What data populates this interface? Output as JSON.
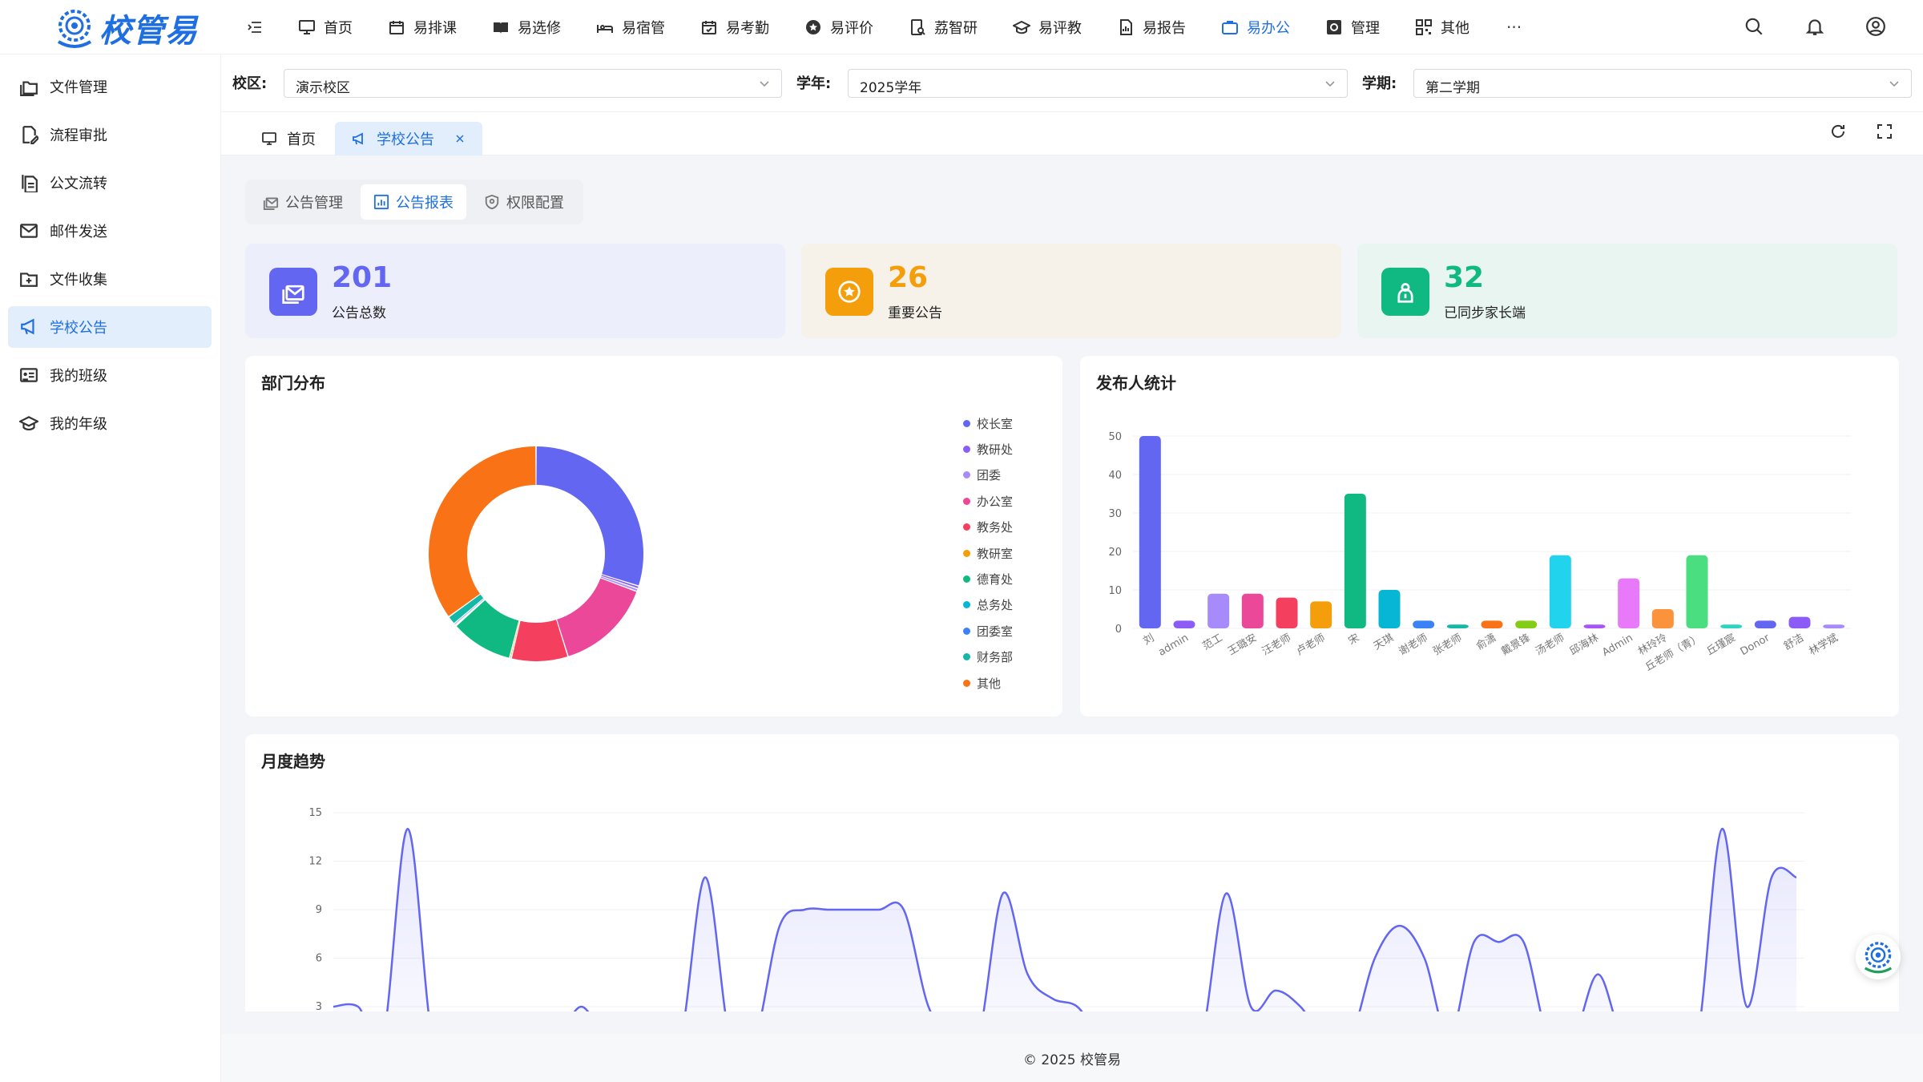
{
  "app": {
    "logo_text": "校管易"
  },
  "nav": [
    {
      "label": "首页",
      "icon": "monitor-icon"
    },
    {
      "label": "易排课",
      "icon": "calendar-icon"
    },
    {
      "label": "易选修",
      "icon": "book-icon"
    },
    {
      "label": "易宿管",
      "icon": "bed-icon"
    },
    {
      "label": "易考勤",
      "icon": "calendar-check-icon"
    },
    {
      "label": "易评价",
      "icon": "star-badge-icon"
    },
    {
      "label": "荔智研",
      "icon": "research-icon"
    },
    {
      "label": "易评教",
      "icon": "graduation-cap-icon"
    },
    {
      "label": "易报告",
      "icon": "report-icon"
    },
    {
      "label": "易办公",
      "icon": "briefcase-icon",
      "active": true
    },
    {
      "label": "管理",
      "icon": "settings-box-icon"
    },
    {
      "label": "其他",
      "icon": "grid-icon"
    }
  ],
  "nav_more": "···",
  "sidebar": [
    {
      "label": "文件管理",
      "icon": "folders-icon"
    },
    {
      "label": "流程审批",
      "icon": "doc-edit-icon"
    },
    {
      "label": "公文流转",
      "icon": "documents-icon"
    },
    {
      "label": "邮件发送",
      "icon": "mail-icon"
    },
    {
      "label": "文件收集",
      "icon": "folder-add-icon"
    },
    {
      "label": "学校公告",
      "icon": "megaphone-icon",
      "active": true
    },
    {
      "label": "我的班级",
      "icon": "class-board-icon"
    },
    {
      "label": "我的年级",
      "icon": "graduation-cap-icon"
    }
  ],
  "filters": {
    "campus_label": "校区:",
    "campus_value": "演示校区",
    "year_label": "学年:",
    "year_value": "2025学年",
    "term_label": "学期:",
    "term_value": "第二学期"
  },
  "page_tabs": [
    {
      "label": "首页",
      "icon": "monitor-icon"
    },
    {
      "label": "学校公告",
      "icon": "megaphone-icon",
      "active": true,
      "closable": true
    }
  ],
  "segments": [
    {
      "label": "公告管理",
      "icon": "mail-stack-icon"
    },
    {
      "label": "公告报表",
      "icon": "chart-icon",
      "active": true
    },
    {
      "label": "权限配置",
      "icon": "shield-icon"
    }
  ],
  "stats": [
    {
      "value": "201",
      "label": "公告总数",
      "color": "#6366f1",
      "bg": "#eceefb",
      "icon": "mail-stack-icon"
    },
    {
      "value": "26",
      "label": "重要公告",
      "color": "#f59e0b",
      "bg": "#f6f1e9",
      "icon": "star-circle-icon"
    },
    {
      "value": "32",
      "label": "已同步家长端",
      "color": "#10b981",
      "bg": "#e8f5f0",
      "icon": "parent-icon"
    }
  ],
  "panels": {
    "dept_title": "部门分布",
    "publisher_title": "发布人统计",
    "monthly_title": "月度趋势"
  },
  "footer": "© 2025 校管易",
  "chart_data": [
    {
      "type": "pie",
      "title": "部门分布",
      "legend_position": "right",
      "categories": [
        "校长室",
        "教研处",
        "团委",
        "办公室",
        "教务处",
        "教研室",
        "德育处",
        "总务处",
        "团委室",
        "财务部",
        "其他"
      ],
      "values": [
        35,
        0.5,
        0.5,
        17,
        10,
        0.3,
        11,
        0.2,
        0.3,
        1.5,
        41
      ],
      "colors": [
        "#6366f1",
        "#8b5cf6",
        "#a78bfa",
        "#ec4899",
        "#f43f5e",
        "#f59e0b",
        "#10b981",
        "#06b6d4",
        "#3b82f6",
        "#14b8a6",
        "#f97316"
      ]
    },
    {
      "type": "bar",
      "title": "发布人统计",
      "categories": [
        "刘",
        "admin",
        "范工",
        "王璐安",
        "汪老师",
        "卢老师",
        "宋",
        "天琪",
        "谢老师",
        "张老师",
        "俞潇",
        "戴景锋",
        "汤老师",
        "邱海林",
        "Admin",
        "林玲玲",
        "丘老师（青）",
        "丘瑾宸",
        "Donor",
        "舒洁",
        "林学斌"
      ],
      "values": [
        50,
        2,
        9,
        9,
        8,
        7,
        35,
        10,
        2,
        1,
        2,
        2,
        19,
        1,
        13,
        5,
        19,
        1,
        2,
        3,
        1
      ],
      "colors": [
        "#6366f1",
        "#8b5cf6",
        "#a78bfa",
        "#ec4899",
        "#f43f5e",
        "#f59e0b",
        "#10b981",
        "#06b6d4",
        "#3b82f6",
        "#14b8a6",
        "#f97316",
        "#84cc16",
        "#22d3ee",
        "#a855f7",
        "#e879f9",
        "#fb923c",
        "#4ade80",
        "#2dd4bf",
        "#6366f1",
        "#8b5cf6",
        "#a78bfa"
      ],
      "yticks": [
        0,
        10,
        20,
        30,
        40,
        50
      ],
      "ylim": [
        0,
        50
      ]
    },
    {
      "type": "area",
      "title": "月度趋势",
      "yticks": [
        3,
        6,
        9,
        12,
        15
      ],
      "ylim": [
        3,
        15
      ],
      "color": "#6366f1",
      "x": [
        0,
        1,
        2,
        3,
        4,
        5,
        6,
        7,
        8,
        9,
        10,
        11,
        12,
        13,
        14,
        15,
        16,
        17,
        18,
        19,
        20,
        21,
        22,
        23,
        24,
        25,
        26,
        27,
        28,
        29,
        30,
        31,
        32,
        33,
        34,
        35,
        36,
        37,
        38,
        39,
        40,
        41,
        42,
        43,
        44,
        45,
        46,
        47,
        48,
        49,
        50,
        51,
        52,
        53,
        54,
        55,
        56,
        57,
        58,
        59
      ],
      "values": [
        3,
        3,
        1,
        14,
        1,
        1,
        1,
        1,
        1,
        1,
        3,
        1,
        1,
        1,
        1,
        11,
        1,
        1,
        8,
        9,
        9,
        9,
        9,
        9,
        3,
        1,
        1,
        10,
        5,
        3.5,
        3,
        1,
        1,
        1,
        1,
        1,
        10,
        3,
        4,
        3,
        1,
        1,
        6,
        8,
        6,
        1,
        7,
        7,
        7,
        1,
        1,
        5,
        1,
        1,
        1,
        1,
        14,
        3,
        11,
        11
      ]
    }
  ]
}
